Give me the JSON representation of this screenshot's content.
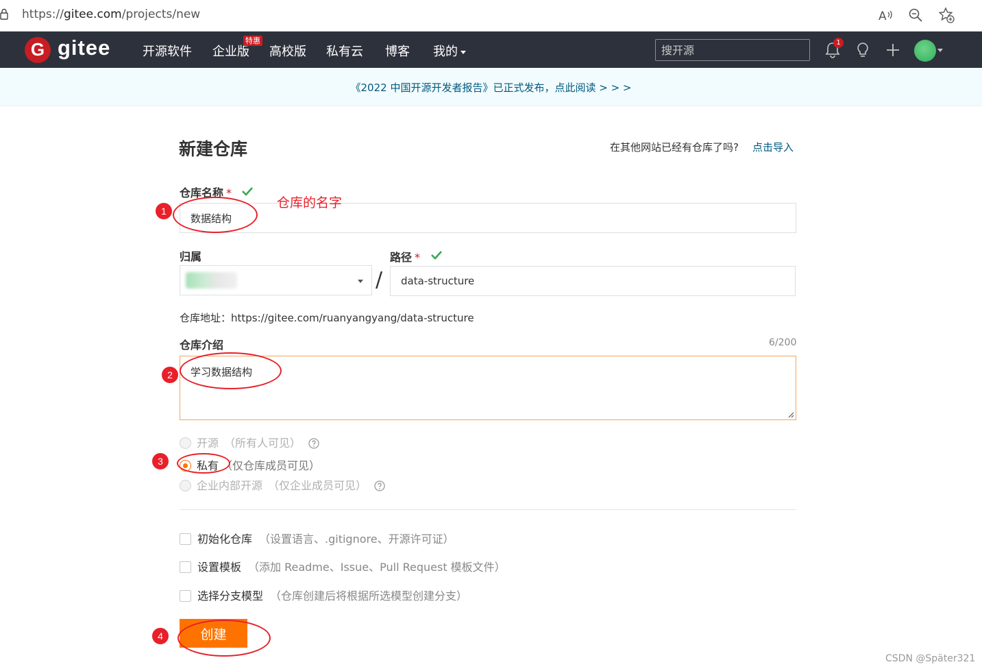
{
  "browser": {
    "url_prefix": "https://",
    "url_host": "gitee.com",
    "url_path": "/projects/new"
  },
  "nav": {
    "logo_text": "gitee",
    "logo_letter": "G",
    "items": [
      "开源软件",
      "企业版",
      "高校版",
      "私有云",
      "博客",
      "我的"
    ],
    "enterprise_badge": "特惠",
    "search_placeholder": "搜开源",
    "notification_count": "1"
  },
  "announcement": "《2022 中国开源开发者报告》已正式发布，点此阅读 > > >",
  "form": {
    "title": "新建仓库",
    "import_question": "在其他网站已经有仓库了吗?",
    "import_link": "点击导入",
    "name_label": "仓库名称",
    "required_mark": "*",
    "name_value": "数据结构",
    "owner_label": "归属",
    "path_label": "路径",
    "path_value": "data-structure",
    "separator": "/",
    "address_label": "仓库地址：",
    "address_value": "https://gitee.com/ruanyangyang/data-structure",
    "desc_label": "仓库介绍",
    "desc_counter": "6/200",
    "desc_value": "学习数据结构",
    "visibility": [
      {
        "label": "开源",
        "hint": "（所有人可见）",
        "selected": false,
        "disabled": true
      },
      {
        "label": "私有",
        "hint": "（仅仓库成员可见）",
        "selected": true,
        "disabled": false
      },
      {
        "label": "企业内部开源",
        "hint": "（仅企业成员可见）",
        "selected": false,
        "disabled": true
      }
    ],
    "options": [
      {
        "label": "初始化仓库",
        "hint": "（设置语言、.gitignore、开源许可证）",
        "checked": false
      },
      {
        "label": "设置模板",
        "hint": "（添加 Readme、Issue、Pull Request 模板文件）",
        "checked": false
      },
      {
        "label": "选择分支模型",
        "hint": "（仓库创建后将根据所选模型创建分支）",
        "checked": false
      }
    ],
    "create_button": "创建"
  },
  "annotations": {
    "markers": [
      "1",
      "2",
      "3",
      "4"
    ],
    "name_note": "仓库的名字",
    "color": "#e8202a"
  },
  "watermark": "CSDN @Später321",
  "colors": {
    "nav_bg": "#2d313b",
    "brand_red": "#c71d23",
    "accent_orange": "#fe7300",
    "link_blue": "#005980",
    "check_green": "#3aa654"
  }
}
